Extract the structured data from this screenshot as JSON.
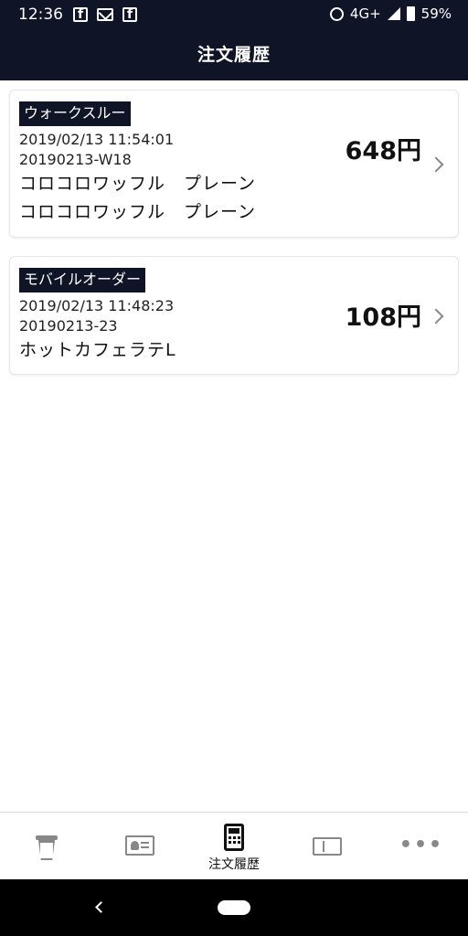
{
  "status_bar": {
    "time": "12:36",
    "network": "4G+",
    "battery": "59%",
    "icons": [
      "facebook-icon",
      "mail-icon",
      "facebook-icon",
      "alarm-icon",
      "signal-icon",
      "battery-icon"
    ]
  },
  "header": {
    "title": "注文履歴"
  },
  "orders": [
    {
      "type": "ウォークスルー",
      "datetime": "2019/02/13 11:54:01",
      "order_number": "20190213-W18",
      "items": [
        "コロコロワッフル　プレーン",
        "コロコロワッフル　プレーン"
      ],
      "price": "648円"
    },
    {
      "type": "モバイルオーダー",
      "datetime": "2019/02/13 11:48:23",
      "order_number": "20190213-23",
      "items": [
        "ホットカフェラテL"
      ],
      "price": "108円"
    }
  ],
  "tabbar": {
    "tabs": [
      {
        "icon": "coffee-cup-icon",
        "label": ""
      },
      {
        "icon": "member-card-icon",
        "label": ""
      },
      {
        "icon": "payment-terminal-icon",
        "label": "注文履歴",
        "active": true
      },
      {
        "icon": "ticket-icon",
        "label": ""
      },
      {
        "icon": "more-icon",
        "label": ""
      }
    ]
  },
  "colors": {
    "header_bg": "#0f1527",
    "tag_bg": "#0f1527",
    "inactive_icon": "#888888",
    "active_icon": "#111111"
  }
}
